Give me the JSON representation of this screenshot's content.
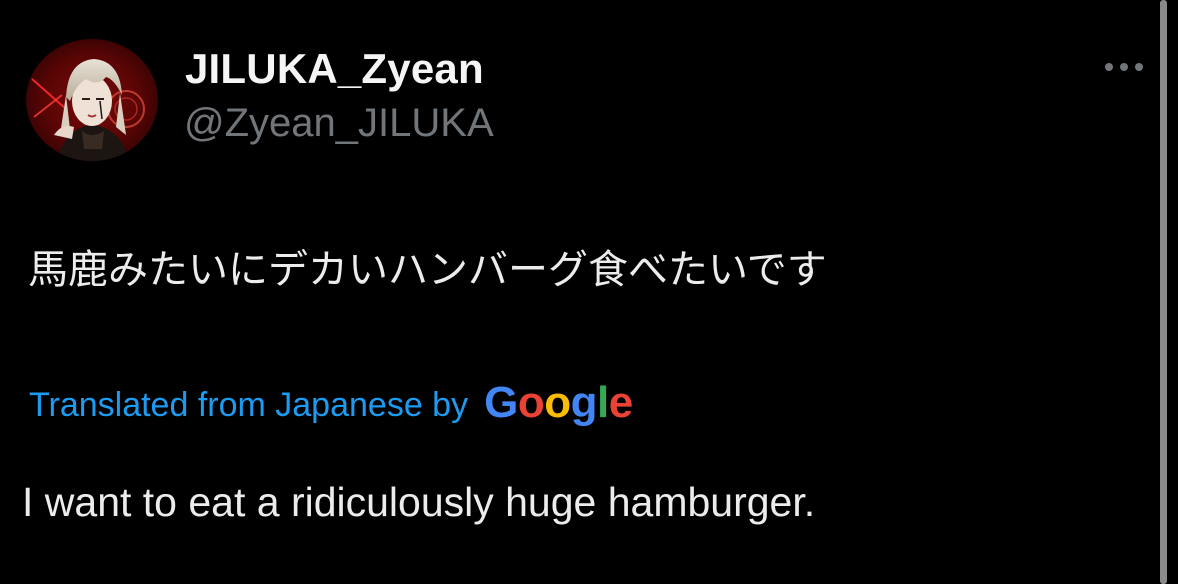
{
  "author": {
    "display_name": "JILUKA_Zyean",
    "handle": "@Zyean_JILUKA",
    "avatar_icon": "avatar-photo"
  },
  "header": {
    "more_icon": "more-dots-icon"
  },
  "tweet": {
    "original_text": "馬鹿みたいにデカいハンバーグ食べたいです",
    "translated_label": "Translated from Japanese by",
    "translator_logo": {
      "letters": [
        "G",
        "o",
        "o",
        "g",
        "l",
        "e"
      ],
      "colors": [
        "#4285f4",
        "#ea4335",
        "#fbbc05",
        "#4285f4",
        "#34a853",
        "#ea4335"
      ]
    },
    "translation": "I want to eat a ridiculously huge hamburger."
  },
  "colors": {
    "background": "#000000",
    "handle": "#71767b",
    "link": "#1d9bf0",
    "text": "#e7e9ea"
  }
}
